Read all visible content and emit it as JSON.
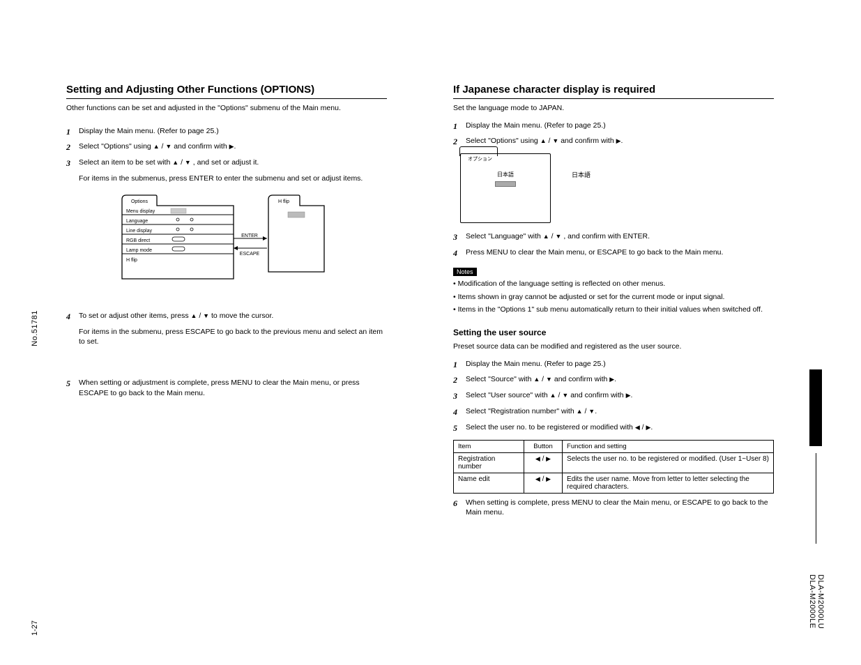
{
  "sideLeft": "No.51781",
  "pageNumber": "1-27",
  "sideRightTop": "DLA-M2000LU",
  "sideRightBottom": "DLA-M2000LE",
  "left": {
    "title": "Setting and Adjusting Other Functions (OPTIONS)",
    "intro": "Other functions can be set and adjusted in the \"Options\" submenu of the Main menu.",
    "steps": {
      "s1": "Display the Main menu. (Refer to page 25.)",
      "s2_pre": "Select \"Options\" using ",
      "s2_post": " and confirm with ",
      "s2_end": ".",
      "s3_pre": "Select an item to be set with ",
      "s3_post": ", and set or adjust it.",
      "s3_sub": "For items in the submenus, press ENTER to enter the submenu and set or adjust items.",
      "s4_pre": "To set or adjust other items, press ",
      "s4_post": " to move the cursor.",
      "s4_sub": "For items in the submenu, press ESCAPE to go back to the previous menu and select an item to set.",
      "s5": "When setting or adjustment is complete, press MENU to clear the Main menu, or press ESCAPE to go back to the Main menu."
    },
    "diagram": {
      "leftBox": {
        "title": "Options",
        "r1": "Menu display",
        "r2": "Language",
        "r3": "Line display",
        "r4": "RGB direct",
        "r5": "Lamp mode",
        "r6": "H flip"
      },
      "rightBox": "H flip",
      "enter": "ENTER",
      "escape": "ESCAPE"
    }
  },
  "right": {
    "sectionA": {
      "title": "If Japanese character display is required",
      "intro": "Set the language mode to JAPAN.",
      "s1": "Display the Main menu. (Refer to page 25.)",
      "s2_pre": "Select \"Options\" using ",
      "s2_mid": " and confirm with ",
      "s2_end": ".",
      "osd": {
        "tab": "オプション",
        "label": "日本語",
        "outside": "日本語"
      },
      "s3_pre": "Select \"Language\" with ",
      "s3_post": ", and confirm with ENTER.",
      "s4": "Press MENU to clear the Main menu, or ESCAPE to go back to the Main menu.",
      "notesLabel": "Notes",
      "note1": "• Modification of the language setting is reflected on other menus.",
      "note2": "• Items shown in gray cannot be adjusted or set for the current mode or input signal.",
      "note3": "• Items in the \"Options 1\" sub menu automatically return to their initial values when switched off."
    },
    "sectionB": {
      "title": "Setting the user source",
      "intro": "Preset source data can be modified and registered as the user source.",
      "s1": "Display the Main menu. (Refer to page 25.)",
      "s2_pre": "Select \"Source\" with ",
      "s2_mid": " and confirm with ",
      "s2_end": ".",
      "s3_pre": "Select \"User source\" with ",
      "s3_mid": " and confirm with ",
      "s3_end": ".",
      "s4_pre": "Select \"Registration number\" with ",
      "s4_end": ".",
      "s5_pre": "Select the user no. to be registered or modified with ",
      "s5_end": ".",
      "table": {
        "h1": "Item",
        "h2": "Button",
        "h3": "Function and setting",
        "r1c1": "Registration number",
        "r1c2": "◀ / ▶",
        "r1c3": "Selects the user no. to be registered or modified. (User 1~User 8)",
        "r2c1": "Name edit",
        "r2c2": "◀ / ▶",
        "r2c3": "Edits the user name. Move from letter to letter selecting the required characters."
      },
      "s6": "When setting is complete, press MENU to clear the Main menu, or ESCAPE to go back to the Main menu."
    }
  }
}
